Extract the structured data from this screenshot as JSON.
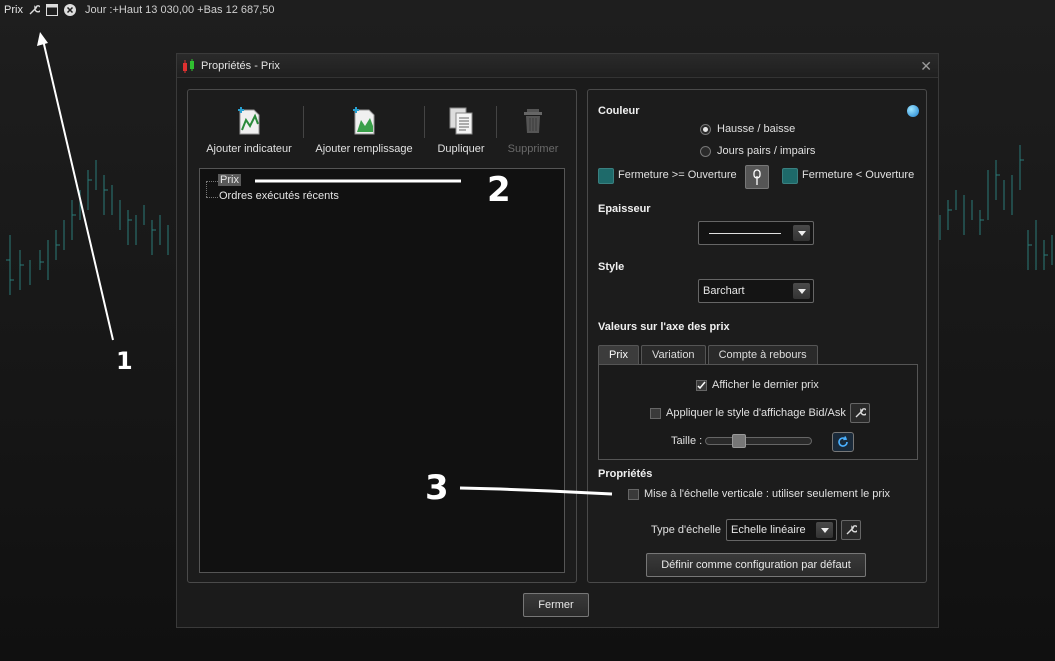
{
  "chart_header": {
    "title": "Prix",
    "info": "Jour :+Haut 13 030,00 +Bas 12 687,50",
    "icons": [
      "wrench-icon",
      "window-icon",
      "close-icon"
    ]
  },
  "dialog": {
    "title": "Propriétés - Prix",
    "toolbar": {
      "add_indicator": "Ajouter indicateur",
      "add_fill": "Ajouter remplissage",
      "duplicate": "Dupliquer",
      "delete": "Supprimer"
    },
    "tree": {
      "items": [
        "Prix",
        "Ordres exécutés récents"
      ]
    },
    "couleur": {
      "heading": "Couleur",
      "radio_1": "Hausse / baisse",
      "radio_2": "Jours pairs / impairs",
      "left_swatch_label": "Fermeture >= Ouverture",
      "right_swatch_label": "Fermeture  < Ouverture",
      "swatch_color": "#1e6a6a"
    },
    "epaisseur": {
      "heading": "Epaisseur"
    },
    "style": {
      "heading": "Style",
      "value": "Barchart"
    },
    "axe": {
      "heading": "Valeurs sur l'axe des prix",
      "tabs": [
        "Prix",
        "Variation",
        "Compte à rebours"
      ],
      "show_last_price": "Afficher le dernier prix",
      "apply_bidask": "Appliquer le style d'affichage Bid/Ask",
      "size_label": "Taille :"
    },
    "proprietes": {
      "heading": "Propriétés",
      "scale_check": "Mise à l'échelle verticale : utiliser seulement le prix",
      "scale_type_label": "Type d'échelle",
      "scale_type_value": "Echelle linéaire",
      "default_button": "Définir comme configuration par défaut"
    },
    "close_button": "Fermer"
  },
  "annotations": {
    "n1": "1",
    "n2": "2",
    "n3": "3"
  }
}
